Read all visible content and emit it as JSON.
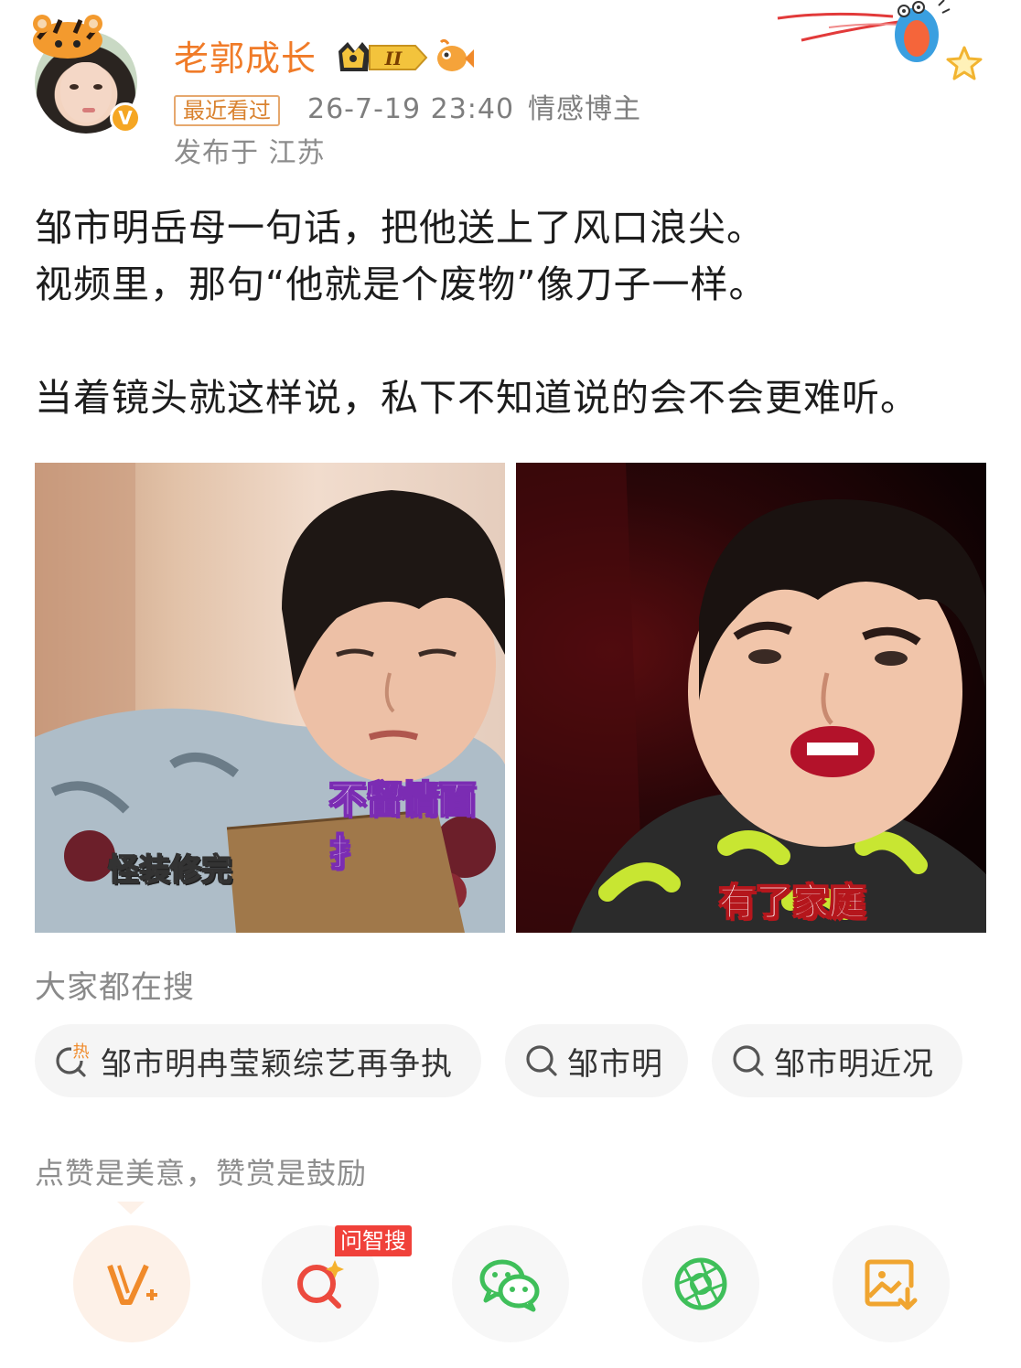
{
  "header": {
    "username": "老郭成长",
    "vip_level": "II",
    "recent_tag": "最近看过",
    "timestamp": "26-7-19 23:40",
    "blogger_tag": "情感博主",
    "location": "发布于 江苏",
    "verified_badge": "V",
    "icons": [
      "avatar",
      "crown-badge-icon",
      "fish-icon",
      "verified-badge-icon",
      "star-icon",
      "snail-icon"
    ]
  },
  "post": {
    "line1": "邹市明岳母一句话，把他送上了风口浪尖。",
    "line2": "视频里，那句“他就是个废物”像刀子一样。",
    "line3": "当着镜头就这样说，私下不知道说的会不会更难听。"
  },
  "images": {
    "left": {
      "caption_top": "不留情面扌",
      "caption_bottom": "怪装修完"
    },
    "right": {
      "caption": "有了家庭"
    }
  },
  "search": {
    "title": "大家都在搜",
    "items": [
      {
        "label": "邹市明冉莹颖综艺再争执",
        "icon": "hot-search-icon",
        "hot_mark": "热"
      },
      {
        "label": "邹市明",
        "icon": "search-icon"
      },
      {
        "label": "邹市明近况",
        "icon": "search-icon"
      }
    ]
  },
  "reward": {
    "text": "点赞是美意，赞赏是鼓励"
  },
  "actions": {
    "hot_tag": "问智搜",
    "items": [
      "reward-icon",
      "ai-search-icon",
      "wechat-icon",
      "moments-icon",
      "save-image-icon"
    ],
    "colors": {
      "orange": "#f08a2a",
      "red": "#ec4a3e",
      "green": "#3fbf5a"
    }
  }
}
